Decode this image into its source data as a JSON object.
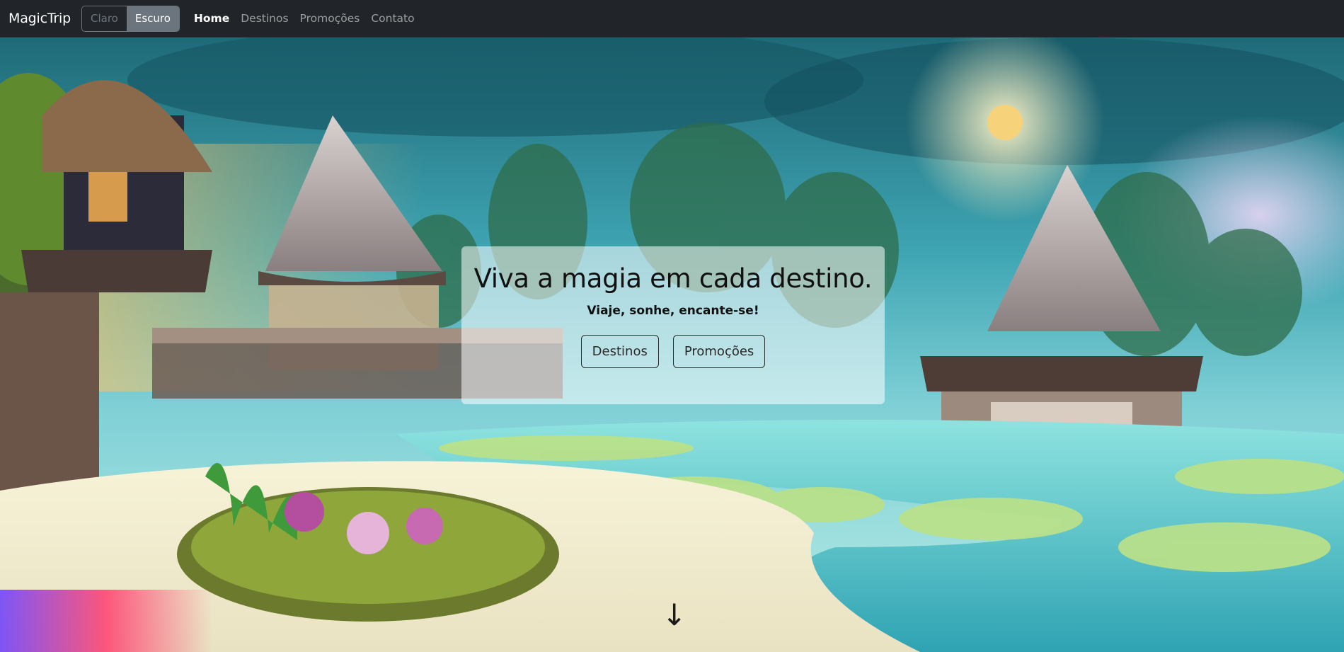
{
  "navbar": {
    "brand": "MagicTrip",
    "theme": {
      "light_label": "Claro",
      "dark_label": "Escuro",
      "selected": "Escuro"
    },
    "links": [
      {
        "label": "Home",
        "active": true
      },
      {
        "label": "Destinos",
        "active": false
      },
      {
        "label": "Promoções",
        "active": false
      },
      {
        "label": "Contato",
        "active": false
      }
    ]
  },
  "hero": {
    "title": "Viva a magia em cada destino.",
    "subtitle": "Viaje, sonhe, encante-se!",
    "buttons": {
      "destinos": "Destinos",
      "promocoes": "Promoções"
    },
    "scroll_icon": "arrow-down-icon",
    "background_description_icon": "fantasy-landscape-image"
  },
  "colors": {
    "navbar_bg": "#212529",
    "card_bg": "rgba(255,255,255,0.55)",
    "theme_active": "#6c757d"
  }
}
